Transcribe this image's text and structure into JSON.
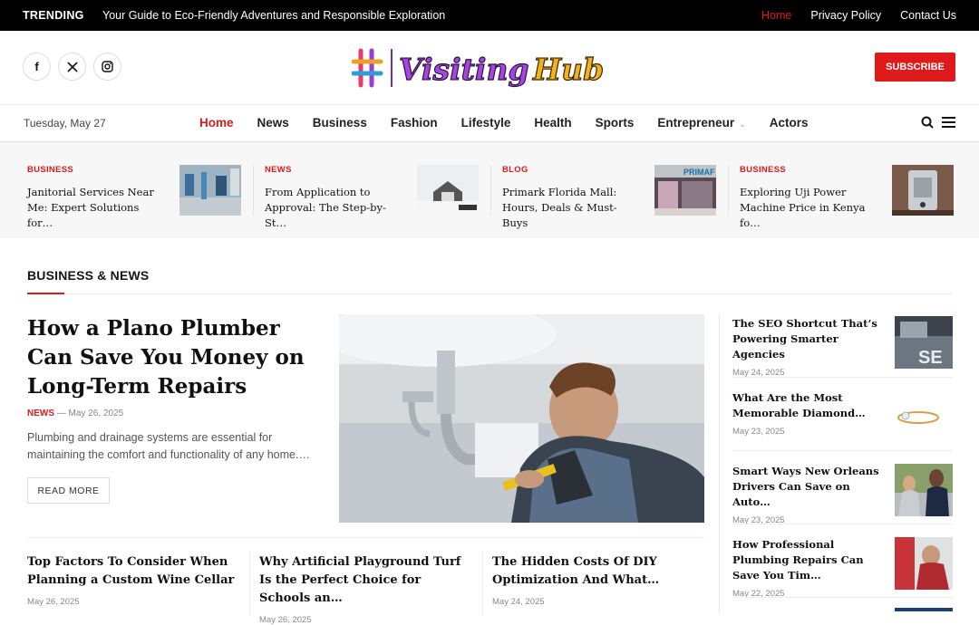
{
  "topbar": {
    "trending_label": "TRENDING",
    "tagline": "Your Guide to Eco-Friendly Adventures and Responsible Exploration",
    "links": [
      "Home",
      "Privacy Policy",
      "Contact Us"
    ]
  },
  "header": {
    "logo_text": "Visiting Hub",
    "subscribe_label": "SUBSCRIBE",
    "social": [
      "facebook-icon",
      "x-icon",
      "instagram-icon"
    ]
  },
  "nav": {
    "date": "Tuesday, May 27",
    "items": [
      "Home",
      "News",
      "Business",
      "Fashion",
      "Lifestyle",
      "Health",
      "Sports",
      "Entrepreneur",
      "Actors"
    ]
  },
  "ticker": [
    {
      "category": "BUSINESS",
      "title": "Janitorial Services Near Me: Expert Solutions for…"
    },
    {
      "category": "NEWS",
      "title": "From Application to Approval: The Step-by-St…"
    },
    {
      "category": "BLOG",
      "title": "Primark Florida Mall: Hours, Deals & Must-Buys"
    },
    {
      "category": "BUSINESS",
      "title": "Exploring Uji Power Machine Price in Kenya fo…"
    }
  ],
  "section_title": "BUSINESS & NEWS",
  "hero": {
    "title": "How a Plano Plumber Can Save You Money on Long-Term Repairs",
    "category": "NEWS",
    "date": "— May 26, 2025",
    "excerpt": "Plumbing and drainage systems are essential for maintaining the comfort and functionality of any home.…",
    "read_more": "READ MORE"
  },
  "sidebar": [
    {
      "title": "The SEO Shortcut That’s Powering Smarter Agencies",
      "date": "May 24, 2025"
    },
    {
      "title": "What Are the Most Memorable Diamond…",
      "date": "May 23, 2025"
    },
    {
      "title": "Smart Ways New Orleans Drivers Can Save on Auto…",
      "date": "May 23, 2025"
    },
    {
      "title": "How Professional Plumbing Repairs Can Save You Tim…",
      "date": "May 22, 2025"
    }
  ],
  "bottom": [
    {
      "title": "Top Factors To Consider When Planning a Custom Wine Cellar",
      "date": "May 26, 2025"
    },
    {
      "title": "Why Artificial Playground Turf Is the Perfect Choice for Schools an…",
      "date": "May 26, 2025"
    },
    {
      "title": "The Hidden Costs Of DIY Optimization And What…",
      "date": "May 24, 2025"
    }
  ],
  "colors": {
    "accent": "#e01a1a",
    "topbar": "#000000"
  }
}
